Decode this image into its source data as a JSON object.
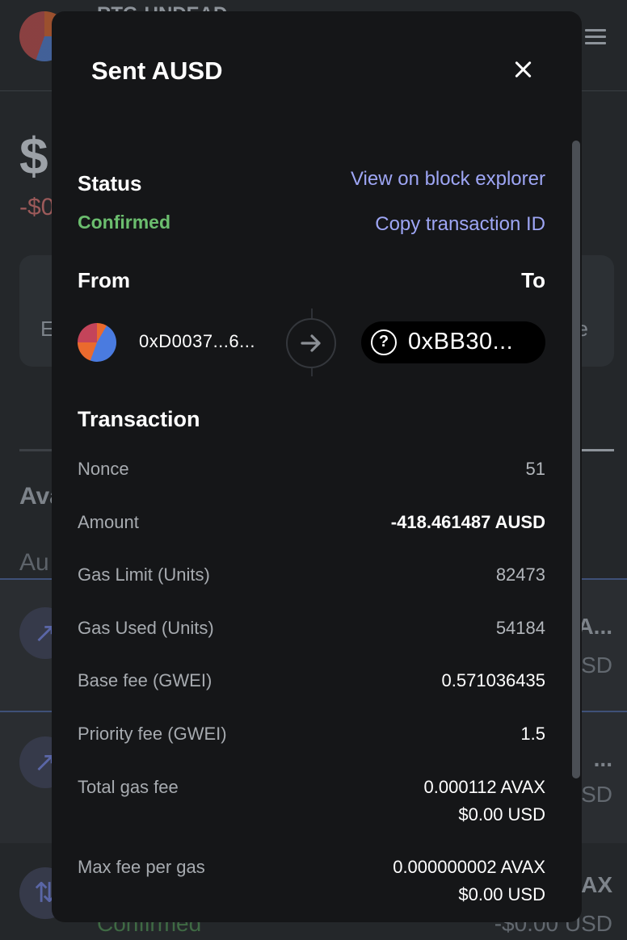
{
  "background": {
    "account_name": "RTG-UNDEAD",
    "balance_partial": "$",
    "change_partial": "-$0",
    "card_left_partial": "E",
    "card_right_partial": "e",
    "section_partial": "Ava",
    "subsection_partial": "Au",
    "rows": [
      {
        "right_title": "A...",
        "right_usd": "SD"
      },
      {
        "right_title": "...",
        "right_usd": "SD"
      },
      {
        "right_title": "AX",
        "right_usd": "-$0.00 USD",
        "status": "Confirmed"
      }
    ]
  },
  "modal": {
    "title": "Sent AUSD",
    "status_label": "Status",
    "status_value": "Confirmed",
    "view_explorer": "View on block explorer",
    "copy_tx": "Copy transaction ID",
    "from_label": "From",
    "to_label": "To",
    "from_address": "0xD0037...6...",
    "to_address": "0xBB30...",
    "to_icon_glyph": "?",
    "transaction_label": "Transaction",
    "details": [
      {
        "label": "Nonce",
        "value": "51"
      },
      {
        "label": "Amount",
        "value": "-418.461487 AUSD"
      },
      {
        "label": "Gas Limit (Units)",
        "value": "82473"
      },
      {
        "label": "Gas Used (Units)",
        "value": "54184"
      },
      {
        "label": "Base fee (GWEI)",
        "value": "0.571036435"
      },
      {
        "label": "Priority fee (GWEI)",
        "value": "1.5"
      },
      {
        "label": "Total gas fee",
        "value": "0.000112 AVAX",
        "value2": "$0.00 USD"
      },
      {
        "label": "Max fee per gas",
        "value": "0.000000002 AVAX",
        "value2": "$0.00 USD"
      }
    ]
  },
  "colors": {
    "confirmed": "#6bbd6e",
    "link": "#9ea6f5",
    "modal_bg": "#151618"
  }
}
